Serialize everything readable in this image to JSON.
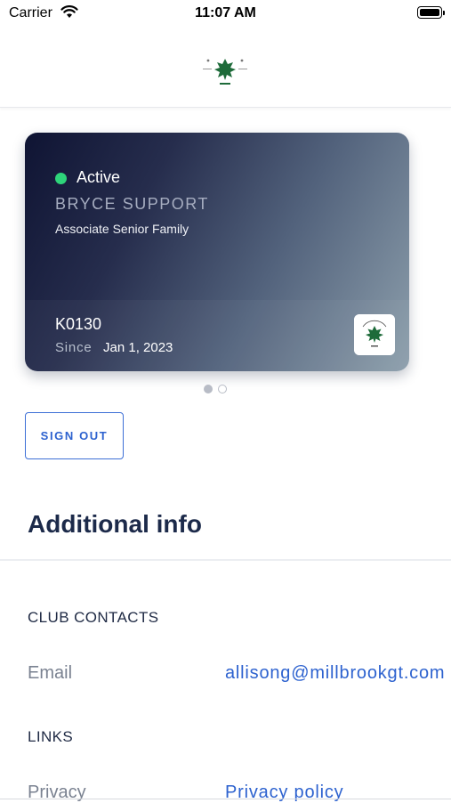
{
  "status_bar": {
    "carrier": "Carrier",
    "time": "11:07 AM"
  },
  "card": {
    "status": "Active",
    "member_name": "BRYCE SUPPORT",
    "membership_type": "Associate Senior Family",
    "member_id": "K0130",
    "since_label": "Since",
    "since_date": "Jan 1, 2023",
    "status_color": "#2ed47a"
  },
  "pager": {
    "current": 1,
    "total": 2
  },
  "sign_out_label": "SIGN OUT",
  "additional_info": {
    "title": "Additional info",
    "club_contacts": {
      "heading": "CLUB CONTACTS",
      "email_label": "Email",
      "email_value": "allisong@millbrookgt.com"
    },
    "links": {
      "heading": "LINKS",
      "privacy_label": "Privacy",
      "privacy_value": "Privacy policy"
    }
  },
  "colors": {
    "accent": "#2d62cf",
    "heading": "#1c2a4a"
  }
}
